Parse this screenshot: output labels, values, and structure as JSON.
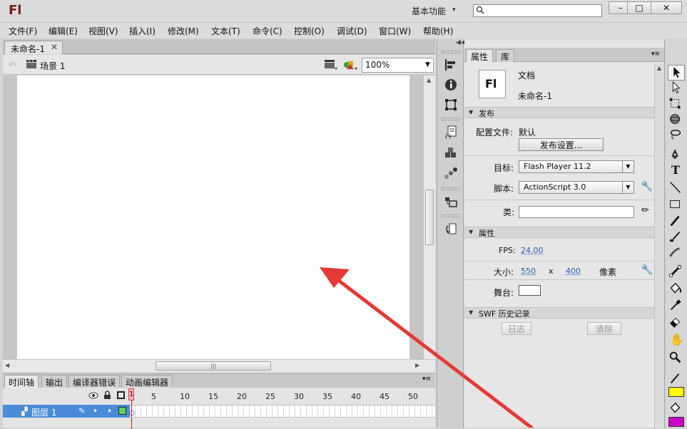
{
  "app": {
    "logo": "Fl",
    "workspace": "基本功能",
    "search_placeholder": ""
  },
  "window_buttons": {
    "minimize": "–",
    "maximize": "□",
    "close": "✕"
  },
  "menu": [
    "文件(F)",
    "编辑(E)",
    "视图(V)",
    "插入(I)",
    "修改(M)",
    "文本(T)",
    "命令(C)",
    "控制(O)",
    "调试(D)",
    "窗口(W)",
    "帮助(H)"
  ],
  "document": {
    "tab_label": "未命名-1",
    "close": "✕"
  },
  "editbar": {
    "scene_label": "场景 1",
    "zoom": "100%"
  },
  "bottom_tabs": [
    "时间轴",
    "输出",
    "编译器错误",
    "动画编辑器"
  ],
  "timeline": {
    "frame_numbers": [
      "5",
      "10",
      "15",
      "20",
      "25",
      "30",
      "35",
      "40",
      "45",
      "50"
    ],
    "current_frame": "1",
    "layer_name": "图层 1"
  },
  "properties": {
    "tabs": [
      "属性",
      "库"
    ],
    "doc_icon_text": "Fl",
    "doc_type": "文档",
    "doc_name": "未命名-1",
    "publish_section": "发布",
    "profile_label": "配置文件:",
    "profile_value": "默认",
    "publish_settings_btn": "发布设置...",
    "target_label": "目标:",
    "target_value": "Flash Player 11.2",
    "script_label": "脚本:",
    "script_value": "ActionScript 3.0",
    "class_label": "类:",
    "props_section": "属性",
    "fps_label": "FPS:",
    "fps_value": "24.00",
    "size_label": "大小:",
    "width_value": "550",
    "x_sep": "x",
    "height_value": "400",
    "unit": "像素",
    "stage_label": "舞台:",
    "stage_color": "#ffffff",
    "swf_section": "SWF 历史记录",
    "log_btn": "日志",
    "clear_btn": "清除"
  },
  "colors": {
    "accent_red": "#e53935",
    "layer_blue": "#4a8cd8",
    "stroke_swatch": "#ffff00",
    "fill_swatch": "#cc00cc"
  }
}
